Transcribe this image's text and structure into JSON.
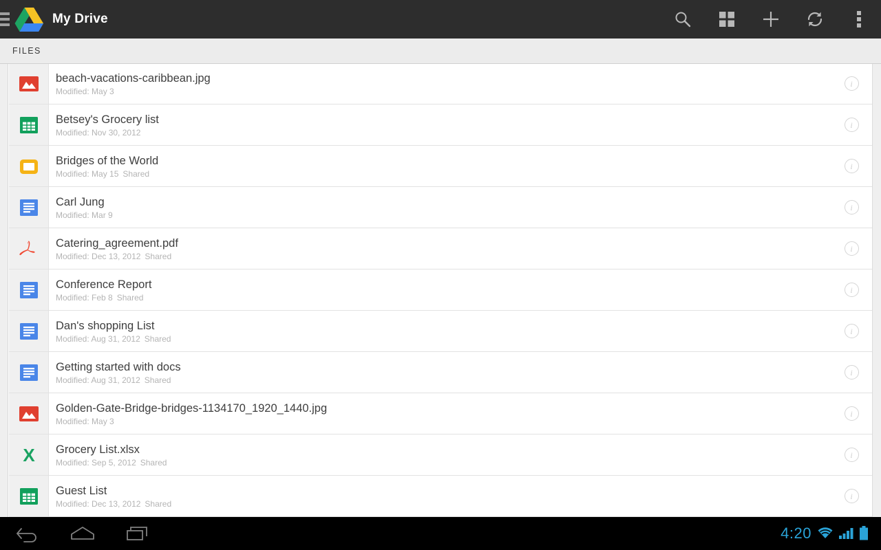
{
  "actionbar": {
    "title": "My Drive",
    "drawer_icon": "hamburger-menu-icon",
    "logo_icon": "google-drive-logo",
    "buttons": [
      {
        "name": "search-button",
        "icon": "search-icon",
        "label": "Search"
      },
      {
        "name": "grid-view-button",
        "icon": "grid-view-icon",
        "label": "Grid view"
      },
      {
        "name": "add-button",
        "icon": "plus-icon",
        "label": "Add"
      },
      {
        "name": "refresh-button",
        "icon": "refresh-icon",
        "label": "Refresh"
      },
      {
        "name": "overflow-button",
        "icon": "more-vertical-icon",
        "label": "More options"
      }
    ]
  },
  "tabs": [
    {
      "label": "FILES",
      "selected": true
    }
  ],
  "list": {
    "info_glyph": "i",
    "modified_prefix": "Modified:",
    "shared_label": "Shared",
    "items": [
      {
        "name": "beach-vacations-caribbean.jpg",
        "modified": "Modified: May 3",
        "shared": "",
        "type": "image"
      },
      {
        "name": "Betsey's Grocery list",
        "modified": "Modified: Nov 30, 2012",
        "shared": "",
        "type": "sheet"
      },
      {
        "name": "Bridges of the World",
        "modified": "Modified: May 15",
        "shared": "Shared",
        "type": "folder"
      },
      {
        "name": "Carl Jung",
        "modified": "Modified: Mar 9",
        "shared": "",
        "type": "doc"
      },
      {
        "name": "Catering_agreement.pdf",
        "modified": "Modified: Dec 13, 2012",
        "shared": "Shared",
        "type": "pdf"
      },
      {
        "name": "Conference Report",
        "modified": "Modified: Feb 8",
        "shared": "Shared",
        "type": "doc"
      },
      {
        "name": "Dan's shopping List",
        "modified": "Modified: Aug 31, 2012",
        "shared": "Shared",
        "type": "doc"
      },
      {
        "name": "Getting started with docs",
        "modified": "Modified: Aug 31, 2012",
        "shared": "Shared",
        "type": "doc"
      },
      {
        "name": "Golden-Gate-Bridge-bridges-1134170_1920_1440.jpg",
        "modified": "Modified: May 3",
        "shared": "",
        "type": "image"
      },
      {
        "name": "Grocery List.xlsx",
        "modified": "Modified: Sep 5, 2012",
        "shared": "Shared",
        "type": "xlsx"
      },
      {
        "name": "Guest List",
        "modified": "Modified: Dec 13, 2012",
        "shared": "Shared",
        "type": "sheet"
      }
    ]
  },
  "navbar": {
    "buttons": [
      {
        "name": "back-button",
        "icon": "back-arrow-icon"
      },
      {
        "name": "home-button",
        "icon": "home-icon"
      },
      {
        "name": "recents-button",
        "icon": "recents-icon"
      }
    ],
    "status": {
      "clock": "4:20",
      "wifi_icon": "wifi-icon",
      "signal_icon": "cellular-signal-icon",
      "battery_icon": "battery-full-icon"
    }
  },
  "colors": {
    "actionbar_bg": "#2d2d2d",
    "tabstrip_bg": "#ececec",
    "image_icon": "#e04030",
    "sheet_icon": "#12a05c",
    "folder_icon": "#f5b316",
    "doc_icon": "#4a86e8",
    "pdf_icon": "#f04a34",
    "xlsx_icon": "#1aa261",
    "status_accent": "#2aa3d8"
  }
}
